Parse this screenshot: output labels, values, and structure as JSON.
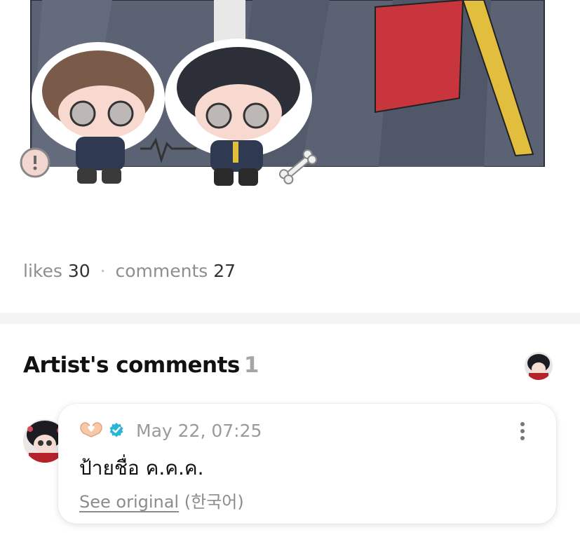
{
  "stats": {
    "likes_label": "likes",
    "likes_count": "30",
    "separator": "·",
    "comments_label": "comments",
    "comments_count": "27"
  },
  "artist_comments": {
    "title": "Artist's comments",
    "count": "1",
    "comment": {
      "badge_icon": "heart-hands-icon",
      "verified_icon": "verified-badge-icon",
      "timestamp": "May 22, 07:25",
      "text": "ป้ายชื่อ ค.ค.ค.",
      "see_original_label": "See original",
      "language": "(한국어)"
    }
  },
  "colors": {
    "verified": "#29b6d6",
    "muted_text": "#8e8e8e",
    "divider": "#f3f3f3"
  }
}
